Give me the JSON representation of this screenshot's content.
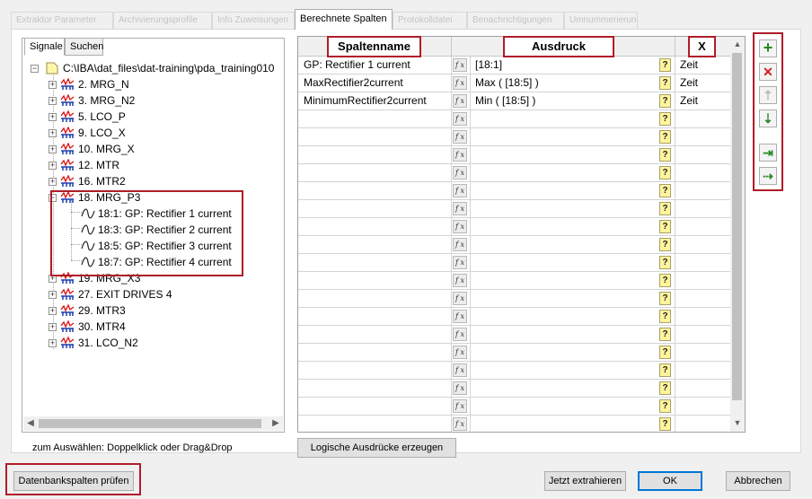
{
  "tabs": [
    {
      "label": "Extraktor Parameter",
      "active": false
    },
    {
      "label": "Archivierungsprofile",
      "active": false
    },
    {
      "label": "Info Zuweisungen",
      "active": false
    },
    {
      "label": "Berechnete Spalten",
      "active": true
    },
    {
      "label": "Protokolldatei",
      "active": false
    },
    {
      "label": "Benachrichtigungen",
      "active": false
    },
    {
      "label": "Umnummerierung",
      "active": false
    }
  ],
  "left_panel": {
    "tabs": [
      "Signale",
      "Suchen"
    ],
    "root": "C:\\IBA\\dat_files\\dat-training\\pda_training010",
    "nodes": [
      {
        "label": "2. MRG_N",
        "expanded": false
      },
      {
        "label": "3. MRG_N2",
        "expanded": false
      },
      {
        "label": "5. LCO_P",
        "expanded": false
      },
      {
        "label": "9. LCO_X",
        "expanded": false
      },
      {
        "label": "10. MRG_X",
        "expanded": false
      },
      {
        "label": "12. MTR",
        "expanded": false
      },
      {
        "label": "16. MTR2",
        "expanded": false
      },
      {
        "label": "18. MRG_P3",
        "expanded": true
      },
      {
        "label": "19. MRG_X3",
        "expanded": false
      },
      {
        "label": "27. EXIT DRIVES 4",
        "expanded": false
      },
      {
        "label": "29. MTR3",
        "expanded": false
      },
      {
        "label": "30. MTR4",
        "expanded": false
      },
      {
        "label": "31. LCO_N2",
        "expanded": false
      }
    ],
    "signals": [
      "18:1: GP: Rectifier 1 current",
      "18:3: GP: Rectifier 2 current",
      "18:5: GP: Rectifier 3 current",
      "18:7: GP: Rectifier 4 current"
    ],
    "hint": "zum Auswählen: Doppelklick oder Drag&Drop"
  },
  "grid": {
    "headers": {
      "name": "Spaltenname",
      "expr": "Ausdruck",
      "x": "X"
    },
    "rows": [
      {
        "name": "GP: Rectifier 1 current",
        "expr": "[18:1]",
        "x": "Zeit"
      },
      {
        "name": "MaxRectifier2current",
        "expr": "Max ( [18:5] )",
        "x": "Zeit"
      },
      {
        "name": "MinimumRectifier2current",
        "expr": "Min ( [18:5] )",
        "x": "Zeit"
      },
      {
        "name": "",
        "expr": "",
        "x": ""
      },
      {
        "name": "",
        "expr": "",
        "x": ""
      },
      {
        "name": "",
        "expr": "",
        "x": ""
      },
      {
        "name": "",
        "expr": "",
        "x": ""
      },
      {
        "name": "",
        "expr": "",
        "x": ""
      },
      {
        "name": "",
        "expr": "",
        "x": ""
      },
      {
        "name": "",
        "expr": "",
        "x": ""
      },
      {
        "name": "",
        "expr": "",
        "x": ""
      },
      {
        "name": "",
        "expr": "",
        "x": ""
      },
      {
        "name": "",
        "expr": "",
        "x": ""
      },
      {
        "name": "",
        "expr": "",
        "x": ""
      },
      {
        "name": "",
        "expr": "",
        "x": ""
      },
      {
        "name": "",
        "expr": "",
        "x": ""
      },
      {
        "name": "",
        "expr": "",
        "x": ""
      },
      {
        "name": "",
        "expr": "",
        "x": ""
      },
      {
        "name": "",
        "expr": "",
        "x": ""
      },
      {
        "name": "",
        "expr": "",
        "x": ""
      },
      {
        "name": "",
        "expr": "",
        "x": ""
      }
    ],
    "fx_glyph": "f x",
    "help_glyph": "?"
  },
  "side_toolbar": [
    {
      "icon": "plus-icon",
      "glyph": "+",
      "color": "#1a8c1a"
    },
    {
      "icon": "delete-icon",
      "glyph": "✕",
      "color": "#d41c1c"
    },
    {
      "icon": "move-up-icon",
      "glyph": "⇡",
      "color": "#b8b8b8"
    },
    {
      "icon": "move-down-icon",
      "glyph": "⇣",
      "color": "#2a8a2a"
    },
    {
      "icon": "import-icon",
      "glyph": "⇥",
      "color": "#2a8a2a"
    },
    {
      "icon": "export-icon",
      "glyph": "⇢",
      "color": "#2a8a2a"
    }
  ],
  "buttons": {
    "generate": "Logische Ausdrücke erzeugen",
    "check_db": "Datenbankspalten prüfen",
    "extract": "Jetzt extrahieren",
    "ok": "OK",
    "cancel": "Abbrechen"
  },
  "colors": {
    "highlight": "#b01c28",
    "accent": "#0078d7"
  }
}
